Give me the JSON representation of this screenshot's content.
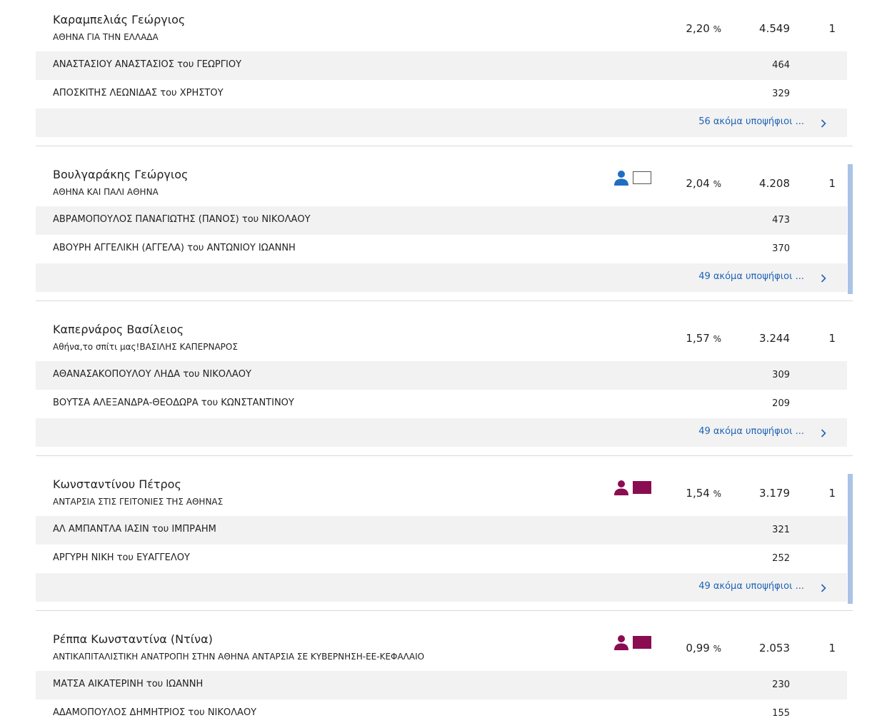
{
  "colors": {
    "link": "#1e63b5",
    "person_blue": "#1f6dc2",
    "person_maroon": "#8a0d52",
    "swatch_maroon": "#8a0d52",
    "accent_bar": "#aac3e6",
    "row_shade": "#f2f2f2"
  },
  "blocks": [
    {
      "candidate": "Καραμπελιάς Γεώργιος",
      "party": "ΑΘΗΝΑ ΓΙΑ ΤΗΝ ΕΛΛΑΔΑ",
      "percent": "2,20",
      "percent_unit": "%",
      "votes": "4.549",
      "seats": "1",
      "person_icon": null,
      "swatch": null,
      "rows": [
        {
          "name": "ΑΝΑΣΤΑΣΙΟΥ ΑΝΑΣΤΑΣΙΟΣ του ΓΕΩΡΓΙΟΥ",
          "votes": "464"
        },
        {
          "name": "ΑΠΟΣΚΙΤΗΣ ΛΕΩΝΙΔΑΣ του ΧΡΗΣΤΟΥ",
          "votes": "329"
        }
      ],
      "more_label": "56 ακόμα υποψήφιοι ...",
      "accent": false
    },
    {
      "candidate": "Βουλγαράκης Γεώργιος",
      "party": "ΑΘΗΝΑ ΚΑΙ ΠΑΛΙ ΑΘΗΝΑ",
      "percent": "2,04",
      "percent_unit": "%",
      "votes": "4.208",
      "seats": "1",
      "person_icon": "user-icon",
      "person_color": "#1f6dc2",
      "swatch": {
        "fill": "#ffffff",
        "border": "#555555"
      },
      "rows": [
        {
          "name": "ΑΒΡΑΜΟΠΟΥΛΟΣ ΠΑΝΑΓΙΩΤΗΣ (ΠΑΝΟΣ) του ΝΙΚΟΛΑΟΥ",
          "votes": "473"
        },
        {
          "name": "ΑΒΟΥΡΗ ΑΓΓΕΛΙΚΗ (ΑΓΓΕΛΑ) του ΑΝΤΩΝΙΟΥ ΙΩΑΝΝΗ",
          "votes": "370"
        }
      ],
      "more_label": "49 ακόμα υποψήφιοι ...",
      "accent": true
    },
    {
      "candidate": "Καπερνάρος Βασίλειος",
      "party": "Αθήνα,το σπίτι μας!ΒΑΣΙΛΗΣ ΚΑΠΕΡΝΑΡΟΣ",
      "percent": "1,57",
      "percent_unit": "%",
      "votes": "3.244",
      "seats": "1",
      "person_icon": null,
      "swatch": null,
      "rows": [
        {
          "name": "ΑΘΑΝΑΣΑΚΟΠΟΥΛΟΥ ΛΗΔΑ του ΝΙΚΟΛΑΟΥ",
          "votes": "309"
        },
        {
          "name": "ΒΟΥΤΣΑ ΑΛΕΞΑΝΔΡΑ-ΘΕΟΔΩΡΑ του ΚΩΝΣΤΑΝΤΙΝΟΥ",
          "votes": "209"
        }
      ],
      "more_label": "49 ακόμα υποψήφιοι ...",
      "accent": false
    },
    {
      "candidate": "Κωνσταντίνου Πέτρος",
      "party": "ΑΝΤΑΡΣΙΑ ΣΤΙΣ ΓΕΙΤΟΝΙΕΣ ΤΗΣ ΑΘΗΝΑΣ",
      "percent": "1,54",
      "percent_unit": "%",
      "votes": "3.179",
      "seats": "1",
      "person_icon": "user-icon",
      "person_color": "#8a0d52",
      "swatch": {
        "fill": "#8a0d52",
        "border": "#8a0d52"
      },
      "rows": [
        {
          "name": "ΑΛ ΑΜΠΑΝΤΛΑ ΙΑΣΙΝ του ΙΜΠΡΑΗΜ",
          "votes": "321"
        },
        {
          "name": "ΑΡΓΥΡΗ ΝΙΚΗ του ΕΥΑΓΓΕΛΟΥ",
          "votes": "252"
        }
      ],
      "more_label": "49 ακόμα υποψήφιοι ...",
      "accent": true
    },
    {
      "candidate": "Ρέππα Κωνσταντίνα (Ντίνα)",
      "party": "ΑΝΤΙΚΑΠΙΤΑΛΙΣΤΙΚΗ ΑΝΑΤΡΟΠΗ ΣΤΗΝ ΑΘΗΝΑ ΑΝΤΑΡΣΙΑ ΣΕ ΚΥΒΕΡΝΗΣΗ-ΕΕ-ΚΕΦΑΛΑΙΟ",
      "percent": "0,99",
      "percent_unit": "%",
      "votes": "2.053",
      "seats": "1",
      "person_icon": "user-icon",
      "person_color": "#8a0d52",
      "swatch": {
        "fill": "#8a0d52",
        "border": "#8a0d52"
      },
      "rows": [
        {
          "name": "ΜΑΤΣΑ ΑΙΚΑΤΕΡΙΝΗ του ΙΩΑΝΝΗ",
          "votes": "230"
        },
        {
          "name": "ΑΔΑΜΟΠΟΥΛΟΣ ΔΗΜΗΤΡΙΟΣ του ΝΙΚΟΛΑΟΥ",
          "votes": "155"
        }
      ],
      "more_label": null,
      "accent": false
    }
  ]
}
